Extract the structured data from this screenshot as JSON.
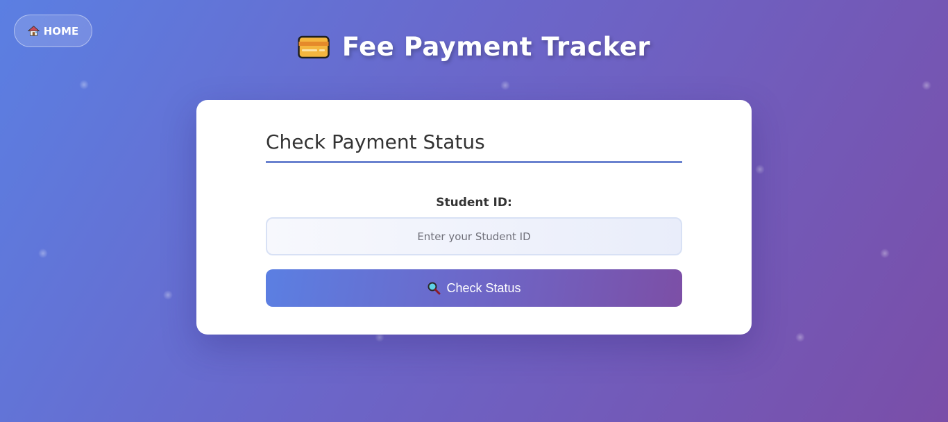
{
  "nav": {
    "home_label": "HOME",
    "home_icon": "house-icon"
  },
  "header": {
    "title": "Fee Payment Tracker",
    "icon": "credit-card-icon"
  },
  "form": {
    "heading": "Check Payment Status",
    "student_id_label": "Student ID:",
    "student_id_placeholder": "Enter your Student ID",
    "student_id_value": "",
    "submit_label": "Check Status",
    "submit_icon": "magnifier-icon"
  },
  "colors": {
    "gradient_start": "#5b7fe2",
    "gradient_end": "#7a4ea8",
    "accent_rule": "#6a82cf"
  }
}
